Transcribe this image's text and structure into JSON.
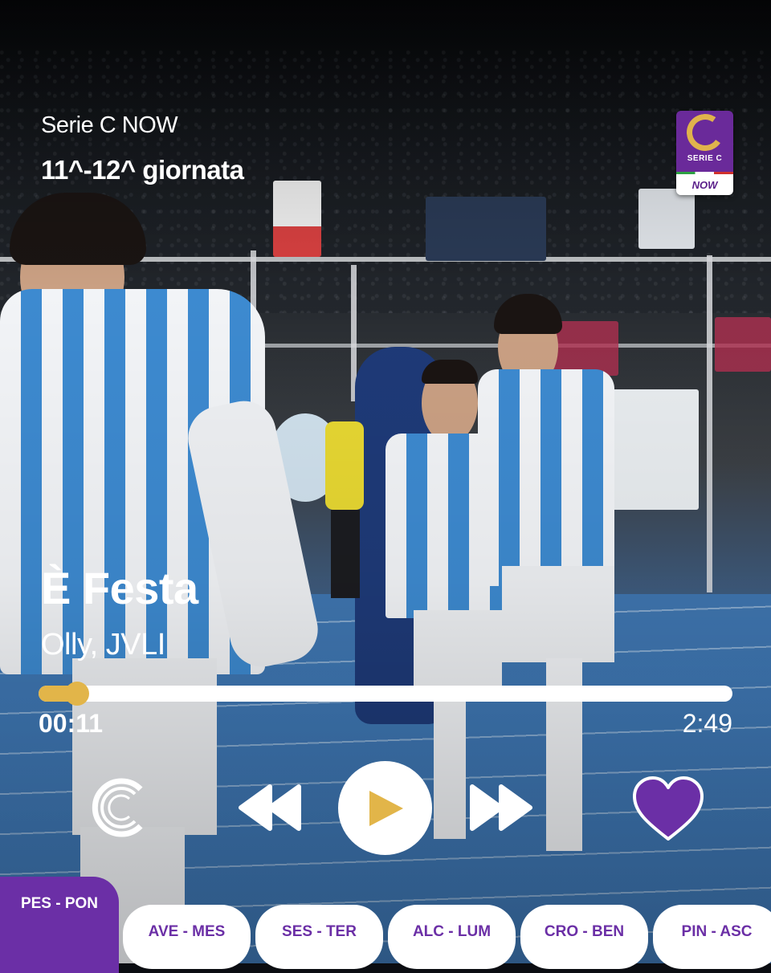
{
  "header": {
    "app_name": "Serie C NOW",
    "round": "11^-12^ giornata"
  },
  "logo": {
    "label": "SERIE C",
    "sub_label": "NOW",
    "colors": {
      "purple": "#6a2a9a",
      "gold": "#e0b34c"
    }
  },
  "track": {
    "title": "È Festa",
    "artist": "Olly, JVLI"
  },
  "player": {
    "progress": 0.055,
    "current_time": "00:11",
    "total_time": "2:49",
    "controls": [
      "brand-logo-icon",
      "rewind-icon",
      "play-icon",
      "fast-forward-icon",
      "heart-icon"
    ],
    "colors": {
      "accent_gold": "#e2b549",
      "accent_purple": "#6b2fa6"
    }
  },
  "matches": {
    "active": "PES - PON",
    "items": [
      "AVE - MES",
      "SES - TER",
      "ALC - LUM",
      "CRO - BEN",
      "PIN - ASC"
    ]
  }
}
